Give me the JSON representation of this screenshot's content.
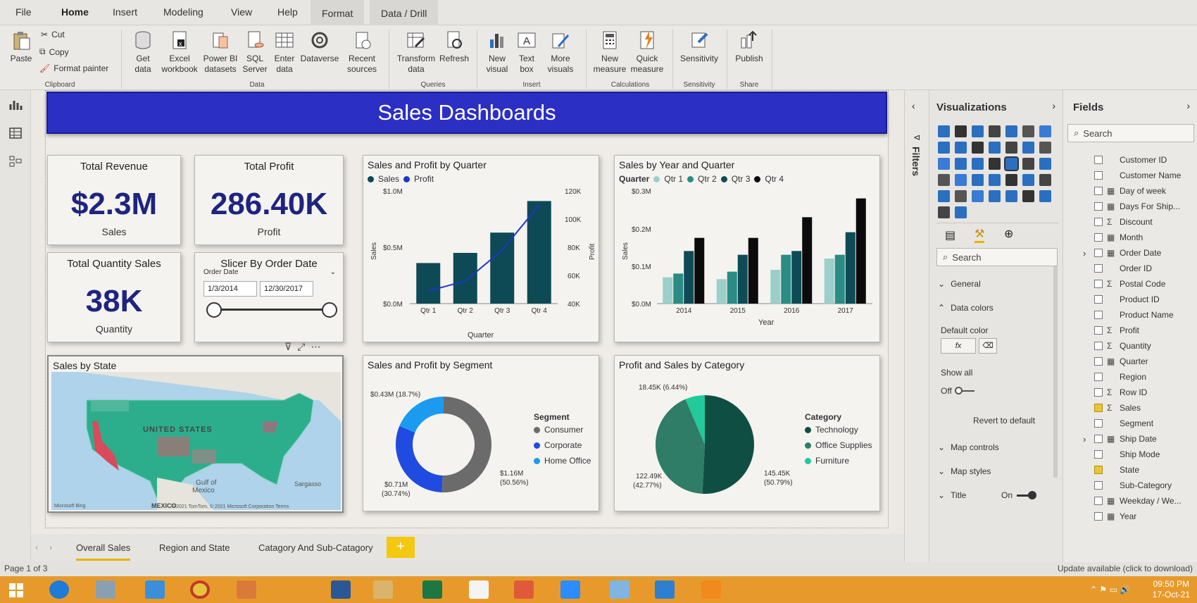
{
  "ribbon": {
    "tabs": [
      "File",
      "Home",
      "Insert",
      "Modeling",
      "View",
      "Help",
      "Format",
      "Data / Drill"
    ],
    "clipboard": {
      "paste": "Paste",
      "cut": "Cut",
      "copy": "Copy",
      "format_painter": "Format painter",
      "group": "Clipboard"
    },
    "data": {
      "get_data": "Get",
      "get_data2": "data",
      "excel": "Excel",
      "excel2": "workbook",
      "pbi": "Power BI",
      "pbi2": "datasets",
      "sql": "SQL",
      "sql2": "Server",
      "enter": "Enter",
      "enter2": "data",
      "dataverse": "Dataverse",
      "recent": "Recent",
      "recent2": "sources",
      "group": "Data"
    },
    "queries": {
      "transform": "Transform",
      "transform2": "data",
      "refresh": "Refresh",
      "group": "Queries"
    },
    "insert": {
      "new_visual": "New",
      "new_visual2": "visual",
      "text_box": "Text",
      "text_box2": "box",
      "more": "More",
      "more2": "visuals",
      "group": "Insert"
    },
    "calc": {
      "new_measure": "New",
      "new_measure2": "measure",
      "quick": "Quick",
      "quick2": "measure",
      "group": "Calculations"
    },
    "sensitivity": {
      "label": "Sensitivity",
      "group": "Sensitivity"
    },
    "share": {
      "publish": "Publish",
      "group": "Share"
    }
  },
  "report": {
    "title": "Sales Dashboards",
    "kpis": [
      {
        "title": "Total Revenue",
        "value": "$2.3M",
        "sub": "Sales"
      },
      {
        "title": "Total Profit",
        "value": "286.40K",
        "sub": "Profit"
      },
      {
        "title": "Total Quantity Sales",
        "value": "38K",
        "sub": "Quantity"
      }
    ],
    "slicer": {
      "title": "Slicer By Order Date",
      "field": "Order Date",
      "start": "1/3/2014",
      "end": "12/30/2017"
    },
    "map": {
      "title": "Sales by State",
      "country": "UNITED STATES",
      "gulf": "Gulf of",
      "gulf2": "Mexico",
      "mexico": "MEXICO",
      "sargasso": "Sargasso",
      "credit": "© 2021 TomTom, © 2021 Microsoft Corporation  Terms",
      "bing": "Microsoft Bing"
    },
    "quarter_chart": {
      "title": "Sales and Profit by Quarter",
      "legend": [
        "Sales",
        "Profit"
      ],
      "y_ticks": [
        "$1.0M",
        "$0.5M",
        "$0.0M"
      ],
      "y2_ticks": [
        "120K",
        "100K",
        "80K",
        "60K",
        "40K"
      ],
      "ylabel": "Sales",
      "y2label": "Profit",
      "xlabel": "Quarter",
      "x_ticks": [
        "Qtr 1",
        "Qtr 2",
        "Qtr 3",
        "Qtr 4"
      ]
    },
    "year_chart": {
      "title": "Sales by Year and Quarter",
      "legend_label": "Quarter",
      "legend": [
        "Qtr 1",
        "Qtr 2",
        "Qtr 3",
        "Qtr 4"
      ],
      "y_ticks": [
        "$0.3M",
        "$0.2M",
        "$0.1M",
        "$0.0M"
      ],
      "ylabel": "Sales",
      "xlabel": "Year",
      "x_ticks": [
        "2014",
        "2015",
        "2016",
        "2017"
      ]
    },
    "segment_chart": {
      "title": "Sales and Profit by Segment",
      "legend_title": "Segment",
      "legend": [
        "Consumer",
        "Corporate",
        "Home Office"
      ],
      "labels": [
        "$0.43M (18.7%)",
        "$0.71M",
        "(30.74%)",
        "$1.16M",
        "(50.56%)"
      ]
    },
    "category_chart": {
      "title": "Profit and Sales by Category",
      "legend_title": "Category",
      "legend": [
        "Technology",
        "Office Supplies",
        "Furniture"
      ],
      "labels": [
        "18.45K (6.44%)",
        "122.49K",
        "(42.77%)",
        "145.45K",
        "(50.79%)"
      ]
    }
  },
  "chart_data": [
    {
      "type": "bar",
      "title": "Sales and Profit by Quarter",
      "categories": [
        "Qtr 1",
        "Qtr 2",
        "Qtr 3",
        "Qtr 4"
      ],
      "series": [
        {
          "name": "Sales",
          "values": [
            0.36,
            0.45,
            0.63,
            0.91
          ]
        },
        {
          "name": "Profit",
          "values": [
            49000,
            56000,
            78000,
            110000
          ]
        }
      ],
      "xlabel": "Quarter",
      "ylabel": "Sales",
      "ylim": [
        0,
        1.0
      ],
      "y2lim": [
        40000,
        120000
      ]
    },
    {
      "type": "bar",
      "title": "Sales by Year and Quarter",
      "categories": [
        "2014",
        "2015",
        "2016",
        "2017"
      ],
      "series": [
        {
          "name": "Qtr 1",
          "values": [
            0.07,
            0.065,
            0.09,
            0.12
          ]
        },
        {
          "name": "Qtr 2",
          "values": [
            0.08,
            0.085,
            0.13,
            0.13
          ]
        },
        {
          "name": "Qtr 3",
          "values": [
            0.14,
            0.13,
            0.14,
            0.19
          ]
        },
        {
          "name": "Qtr 4",
          "values": [
            0.175,
            0.175,
            0.23,
            0.28
          ]
        }
      ],
      "xlabel": "Year",
      "ylabel": "Sales",
      "ylim": [
        0,
        0.3
      ]
    },
    {
      "type": "pie",
      "title": "Sales and Profit by Segment",
      "categories": [
        "Consumer",
        "Corporate",
        "Home Office"
      ],
      "values": [
        50.56,
        30.74,
        18.7
      ]
    },
    {
      "type": "pie",
      "title": "Profit and Sales by Category",
      "categories": [
        "Technology",
        "Office Supplies",
        "Furniture"
      ],
      "values": [
        50.79,
        42.77,
        6.44
      ]
    }
  ],
  "pages": {
    "tabs": [
      "Overall Sales",
      "Region and State",
      "Catagory And Sub-Catagory"
    ],
    "add": "+"
  },
  "status": {
    "page": "Page 1 of 3",
    "update": "Update available (click to download)"
  },
  "filters": {
    "label": "Filters"
  },
  "viz_pane": {
    "title": "Visualizations",
    "search": "Search",
    "sections": [
      "General",
      "Data colors",
      "Map controls",
      "Map styles",
      "Title"
    ],
    "default_color": "Default color",
    "fx": "fx",
    "show_all": "Show all",
    "off": "Off",
    "revert": "Revert to default",
    "on": "On"
  },
  "fields_pane": {
    "title": "Fields",
    "search": "Search",
    "items": [
      {
        "name": "Customer ID",
        "sigma": "",
        "checked": false
      },
      {
        "name": "Customer Name",
        "sigma": "",
        "checked": false
      },
      {
        "name": "Day of week",
        "sigma": "▦",
        "checked": false
      },
      {
        "name": "Days For Ship...",
        "sigma": "▦",
        "checked": false
      },
      {
        "name": "Discount",
        "sigma": "Σ",
        "checked": false
      },
      {
        "name": "Month",
        "sigma": "▦",
        "checked": false
      },
      {
        "name": "Order Date",
        "sigma": "▦",
        "checked": false
      },
      {
        "name": "Order ID",
        "sigma": "",
        "checked": false
      },
      {
        "name": "Postal Code",
        "sigma": "Σ",
        "checked": false
      },
      {
        "name": "Product ID",
        "sigma": "",
        "checked": false
      },
      {
        "name": "Product Name",
        "sigma": "",
        "checked": false
      },
      {
        "name": "Profit",
        "sigma": "Σ",
        "checked": false
      },
      {
        "name": "Quantity",
        "sigma": "Σ",
        "checked": false
      },
      {
        "name": "Quarter",
        "sigma": "▦",
        "checked": false
      },
      {
        "name": "Region",
        "sigma": "",
        "checked": false
      },
      {
        "name": "Row ID",
        "sigma": "Σ",
        "checked": false
      },
      {
        "name": "Sales",
        "sigma": "Σ",
        "checked": true
      },
      {
        "name": "Segment",
        "sigma": "",
        "checked": false
      },
      {
        "name": "Ship Date",
        "sigma": "▦",
        "checked": false
      },
      {
        "name": "Ship Mode",
        "sigma": "",
        "checked": false
      },
      {
        "name": "State",
        "sigma": "",
        "checked": true
      },
      {
        "name": "Sub-Category",
        "sigma": "",
        "checked": false
      },
      {
        "name": "Weekday / We...",
        "sigma": "▦",
        "checked": false
      },
      {
        "name": "Year",
        "sigma": "▦",
        "checked": false
      }
    ]
  },
  "taskbar": {
    "time": "09:50 PM",
    "date": "17-Oct-21"
  },
  "colors": {
    "banner": "#2b2fc4",
    "kpi": "#1e247f",
    "teal_dark": "#0d4a55",
    "teal": "#1a6a73",
    "teal_light": "#9ccfc9",
    "black": "#0b0b0b",
    "consumer": "#6b6b6b",
    "corporate": "#1f4be0",
    "home_office": "#1a9bf0",
    "technology": "#0f4f43",
    "office": "#2f7d67",
    "furniture": "#22c99a",
    "accent": "#f2c811"
  }
}
